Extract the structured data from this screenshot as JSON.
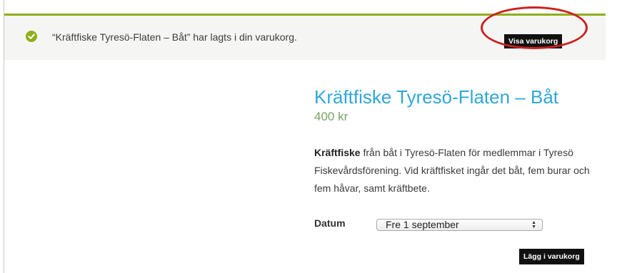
{
  "notice": {
    "message": "“Kräftfiske Tyresö-Flaten – Båt” har lagts i din varukorg.",
    "view_cart_label": "Visa varukorg",
    "accent_color": "#8fae1b",
    "icon": "check-circle-icon"
  },
  "product": {
    "title": "Kräftfiske Tyresö-Flaten – Båt",
    "price": "400 kr",
    "description_bold": "Kräftfiske",
    "description_rest": " från båt i Tyresö-Flaten för medlemmar i Tyresö Fiskevårdsförening. Vid kräftfisket ingår det båt, fem burar och fem håvar, samt kräftbete.",
    "title_color": "#30a7d8",
    "price_color": "#77a464"
  },
  "form": {
    "date_label": "Datum",
    "date_selected": "Fre 1 september",
    "add_to_cart_label": "Lägg i varukorg"
  },
  "annotation": {
    "ring_color": "#cc1f1f"
  }
}
